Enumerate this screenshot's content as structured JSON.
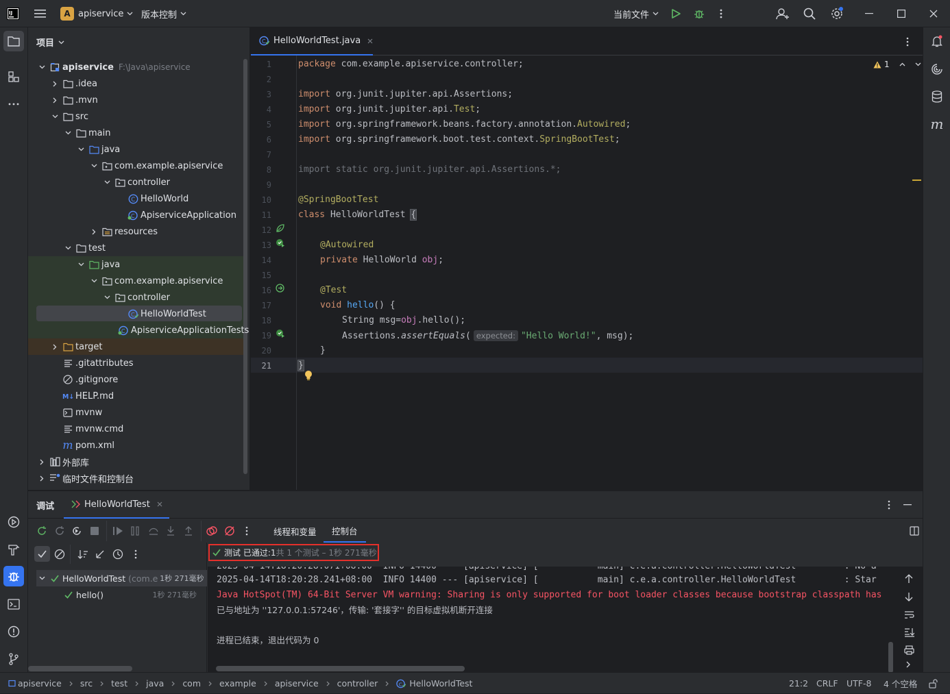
{
  "titlebar": {
    "project_badge": "A",
    "project_name": "apiservice",
    "vcs_menu": "版本控制",
    "run_config": "当前文件"
  },
  "project_panel": {
    "title": "项目",
    "root_name": "apiservice",
    "root_path": "F:\\Java\\apiservice",
    "items": [
      {
        "label": "apiservice",
        "icon": "module-icon"
      },
      {
        "label": ".idea",
        "icon": "folder-icon"
      },
      {
        "label": ".mvn",
        "icon": "folder-icon"
      },
      {
        "label": "src",
        "icon": "folder-icon"
      },
      {
        "label": "main",
        "icon": "folder-icon"
      },
      {
        "label": "java",
        "icon": "source-folder-icon"
      },
      {
        "label": "com.example.apiservice",
        "icon": "package-icon"
      },
      {
        "label": "controller",
        "icon": "package-icon"
      },
      {
        "label": "HelloWorld",
        "icon": "class-icon"
      },
      {
        "label": "ApiserviceApplication",
        "icon": "spring-class-icon"
      },
      {
        "label": "resources",
        "icon": "resources-folder-icon"
      },
      {
        "label": "test",
        "icon": "folder-icon"
      },
      {
        "label": "java",
        "icon": "test-source-folder-icon"
      },
      {
        "label": "com.example.apiservice",
        "icon": "package-icon"
      },
      {
        "label": "controller",
        "icon": "package-icon"
      },
      {
        "label": "HelloWorldTest",
        "icon": "test-class-icon"
      },
      {
        "label": "ApiserviceApplicationTests",
        "icon": "spring-class-icon"
      },
      {
        "label": "target",
        "icon": "excluded-folder-icon"
      },
      {
        "label": ".gitattributes",
        "icon": "text-file-icon"
      },
      {
        "label": ".gitignore",
        "icon": "ignore-file-icon"
      },
      {
        "label": "HELP.md",
        "icon": "markdown-icon"
      },
      {
        "label": "mvnw",
        "icon": "shell-file-icon"
      },
      {
        "label": "mvnw.cmd",
        "icon": "text-file-icon"
      },
      {
        "label": "pom.xml",
        "icon": "maven-icon"
      },
      {
        "label": "外部库",
        "icon": "library-icon"
      },
      {
        "label": "临时文件和控制台",
        "icon": "scratch-icon"
      }
    ]
  },
  "editor": {
    "tab_label": "HelloWorldTest.java",
    "warning_count": "1",
    "line_numbers": [
      "1",
      "2",
      "3",
      "4",
      "5",
      "6",
      "7",
      "8",
      "9",
      "10",
      "11",
      "12",
      "13",
      "14",
      "15",
      "16",
      "17",
      "18",
      "19",
      "20",
      "21"
    ],
    "code": {
      "l1_kw": "package",
      "l1_rest": " com.example.apiservice.controller;",
      "l3_kw": "import",
      "l3_rest": " org.junit.jupiter.api.Assertions;",
      "l4_kw": "import",
      "l4_a": " org.junit.jupiter.api.",
      "l4_b": "Test",
      "l4_c": ";",
      "l5_kw": "import",
      "l5_a": " org.springframework.beans.factory.annotation.",
      "l5_b": "Autowired",
      "l5_c": ";",
      "l6_kw": "import",
      "l6_a": " org.springframework.boot.test.context.",
      "l6_b": "SpringBootTest",
      "l6_c": ";",
      "l8": "import static org.junit.jupiter.api.Assertions.*;",
      "l10": "@SpringBootTest",
      "l11_kw": "class",
      "l11_rest": " HelloWorldTest ",
      "l11_brace": "{",
      "l13": "@Autowired",
      "l14_kw": "private",
      "l14_a": " HelloWorld ",
      "l14_b": "obj",
      "l14_c": ";",
      "l16": "@Test",
      "l17_kw": "void",
      "l17_fn": "hello",
      "l17_rest": "() {",
      "l18_a": "String msg=",
      "l18_b": "obj",
      "l18_c": ".hello();",
      "l19_a": "Assertions.",
      "l19_b": "assertEquals",
      "l19_c": "(",
      "l19_hint": "expected:",
      "l19_str": "\"Hello World!\"",
      "l19_d": ", msg);",
      "l20": "}",
      "l21": "}"
    }
  },
  "debug_panel": {
    "tab_debug": "调试",
    "tab_session": "HelloWorldTest",
    "tab_threads": "线程和变量",
    "tab_console": "控制台",
    "test_status_prefix": "测试 已通过: ",
    "test_status_count": "1",
    "test_status_suffix": "共 1 个测试 – 1秒 271毫秒",
    "tree": [
      {
        "label": "HelloWorldTest",
        "detail": "(com.e",
        "time": "1秒 271毫秒"
      },
      {
        "label": "hello()",
        "time": "1秒 271毫秒"
      }
    ],
    "console_lines": [
      "2025-04-14T18:20:28.241+08:00  INFO 14400 --- [apiservice] [           main] c.e.a.controller.HelloWorldTest         : Star",
      "Java HotSpot(TM) 64-Bit Server VM warning: Sharing is only supported for boot loader classes because bootstrap classpath has",
      "已与地址为 ''127.0.0.1:57246'，传输: '套接字'' 的目标虚拟机断开连接",
      "进程已结束，退出代码为 0"
    ],
    "console_partial_top": "2025-04-14T18:20:28.071+08:00  INFO 14400 --- [apiservice] [           main] c.e.a.controller.HelloWorldTest         : No a"
  },
  "statusbar": {
    "breadcrumbs": [
      "apiservice",
      "src",
      "test",
      "java",
      "com",
      "example",
      "apiservice",
      "controller",
      "HelloWorldTest"
    ],
    "position": "21:2",
    "line_sep": "CRLF",
    "encoding": "UTF-8",
    "indent": "4 个空格"
  },
  "colors": {
    "accent": "#3574f0",
    "bg_editor": "#1e1f22",
    "bg_panel": "#2b2d30",
    "pass_green": "#5fb865",
    "error_red": "#f75464",
    "highlight_box": "#e5302b"
  }
}
